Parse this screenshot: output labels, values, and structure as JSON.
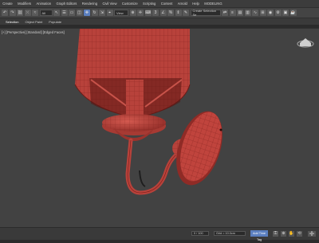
{
  "menu": [
    "Create",
    "Modifiers",
    "Animation",
    "Graph Editors",
    "Rendering",
    "Civil View",
    "Customize",
    "Scripting",
    "Content",
    "Arnold",
    "Help",
    "MODELING"
  ],
  "toolbar": {
    "selection_filter": "All",
    "view_dropdown": "View",
    "named_selection": "Create Selection Se"
  },
  "ribbon_tabs": [
    "Selection",
    "Object Paint",
    "Populate"
  ],
  "viewport": {
    "label": "[+] [Perspective] [Standard] [Edged Faces]",
    "model_color": "#c0443d",
    "wire_color": "#7a1e1a",
    "background": "#424242"
  },
  "statusbar": {
    "frame_counter": "0 / 100",
    "grid": "Grid = 10.0cm",
    "add_time_tag": "Add Time Tag",
    "auto_key_icon": "key-icon"
  }
}
